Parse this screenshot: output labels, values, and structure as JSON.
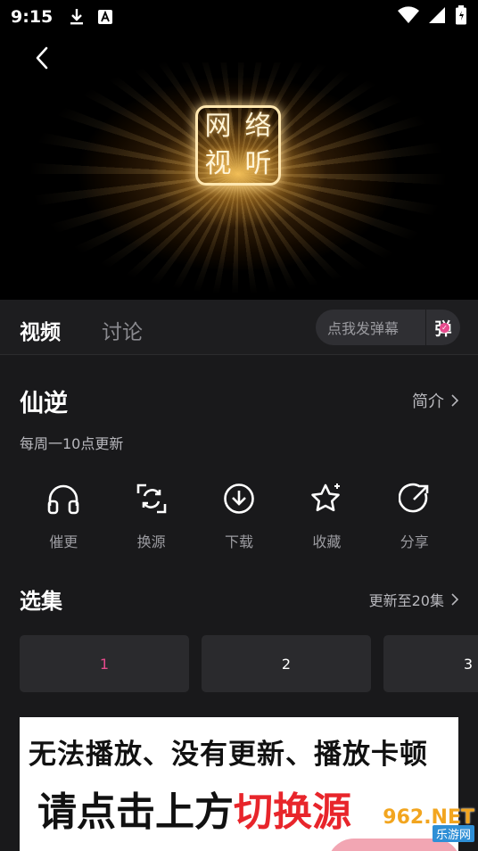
{
  "status_bar": {
    "time": "9:15",
    "left_icons": [
      "download-icon",
      "a-notification-icon"
    ],
    "right_icons": [
      "wifi-icon",
      "signal-icon",
      "battery-icon"
    ]
  },
  "player": {
    "logo_chars": [
      "网",
      "络",
      "视",
      "听"
    ]
  },
  "tabs": [
    {
      "label": "视频",
      "active": true
    },
    {
      "label": "讨论",
      "active": false
    }
  ],
  "danmaku": {
    "placeholder": "点我发弹幕",
    "button_label": "弹"
  },
  "show": {
    "title": "仙逆",
    "intro_label": "简介",
    "schedule": "每周一10点更新"
  },
  "actions": [
    {
      "label": "催更",
      "icon": "headphones-icon"
    },
    {
      "label": "换源",
      "icon": "switch-source-icon"
    },
    {
      "label": "下载",
      "icon": "download-circle-icon"
    },
    {
      "label": "收藏",
      "icon": "star-icon"
    },
    {
      "label": "分享",
      "icon": "share-icon"
    }
  ],
  "episodes_section": {
    "title": "选集",
    "update_label": "更新至20集",
    "episodes": [
      "1",
      "2",
      "3"
    ],
    "selected": "1"
  },
  "banner": {
    "line1": "无法播放、没有更新、播放卡顿",
    "line2_prefix": "请点击上方",
    "line2_highlight": "切换源"
  },
  "watermark": {
    "number": "962.NET",
    "site": "乐游网"
  },
  "colors": {
    "background": "#19191b",
    "accent_pink": "#e64a8c",
    "highlight_red": "#e8252b",
    "muted_text": "#9b9ba0"
  }
}
